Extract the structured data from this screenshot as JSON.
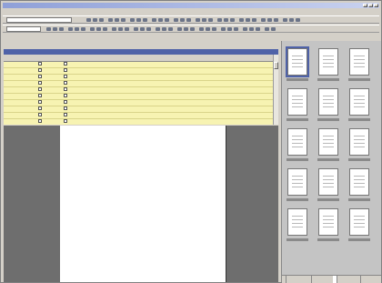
{
  "window": {
    "title": ""
  },
  "menu": {
    "items": [
      "",
      "",
      "",
      "",
      "",
      "",
      "",
      ""
    ]
  },
  "toolbar": {
    "combo_left": "",
    "combo_mid": ""
  },
  "records_panel": {
    "title": ""
  },
  "grid": {
    "columns": [
      "",
      "",
      "",
      "",
      "",
      "",
      "",
      "",
      "",
      "",
      ""
    ],
    "rows": [
      {
        "name": "",
        "date": "",
        "checked": true
      },
      {
        "name": "",
        "date": "",
        "checked": true
      },
      {
        "name": "",
        "date": "",
        "checked": true
      },
      {
        "name": "",
        "date": "",
        "checked": true
      },
      {
        "name": "",
        "date": "",
        "checked": true
      },
      {
        "name": "",
        "date": "",
        "checked": true
      },
      {
        "name": "",
        "date": "",
        "checked": true
      },
      {
        "name": "",
        "date": "",
        "checked": true
      },
      {
        "name": "",
        "date": "",
        "checked": true
      },
      {
        "name": "",
        "date": "",
        "checked": true
      }
    ]
  },
  "preview": {
    "heading": "",
    "lines": [
      "",
      "",
      "",
      "",
      ""
    ]
  },
  "sidebar": {
    "tabs": [
      "",
      "",
      "",
      ""
    ],
    "selected_thumb": 0
  },
  "colors": {
    "grid_bg": "#f7f3b2",
    "panel_header": "#4f62a8",
    "preview_bg": "#6e6e6e"
  }
}
